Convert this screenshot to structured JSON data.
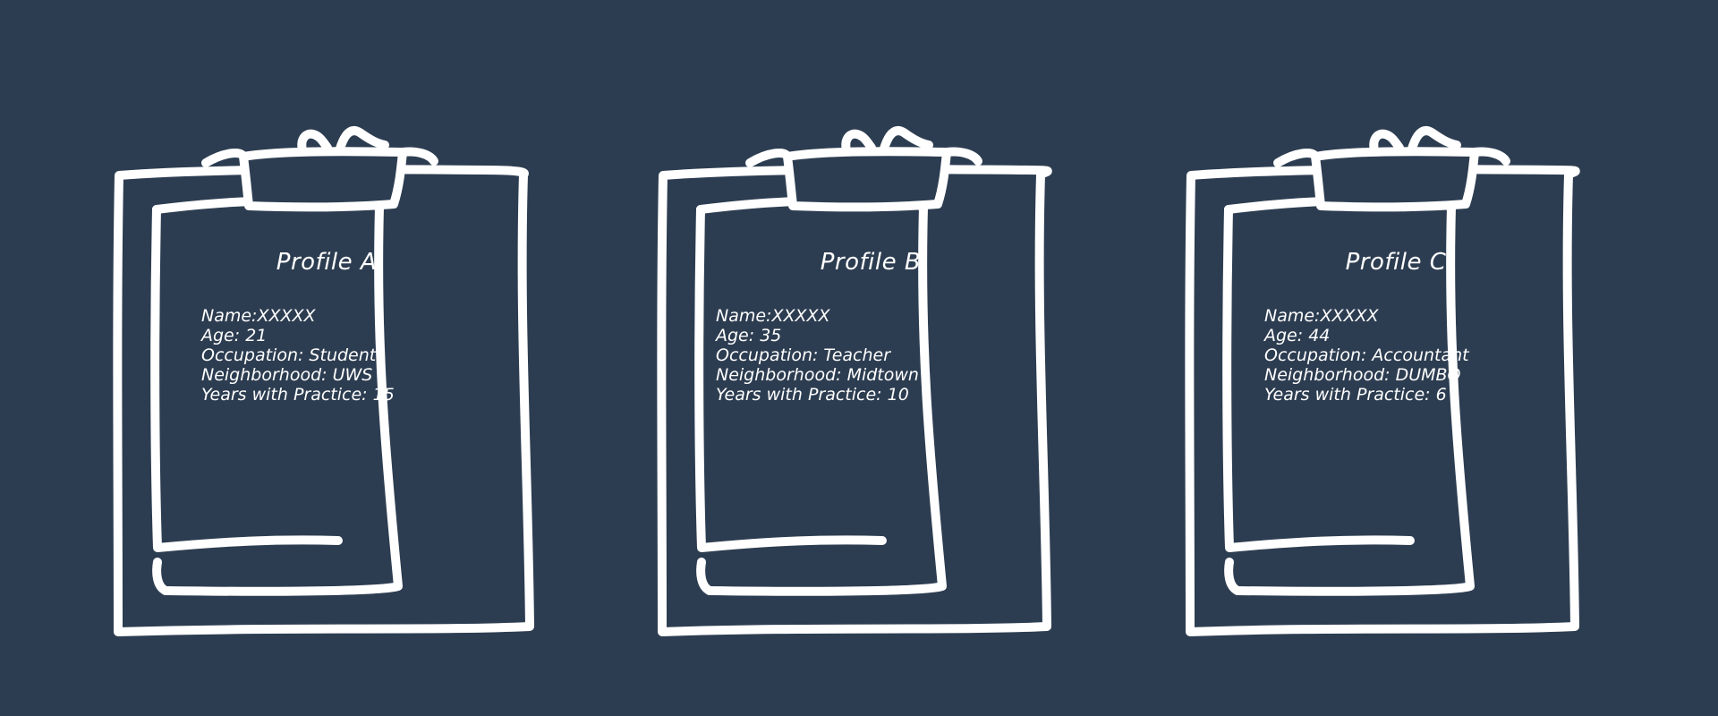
{
  "profiles": [
    {
      "title": "Profile A",
      "name_line": "Name:XXXXX",
      "age_line": "Age: 21",
      "occupation_line": "Occupation: Student",
      "neighborhood_line": "Neighborhood: UWS",
      "years_line": "Years with Practice: 15"
    },
    {
      "title": "Profile B",
      "name_line": "Name:XXXXX",
      "age_line": "Age: 35",
      "occupation_line": "Occupation: Teacher",
      "neighborhood_line": "Neighborhood: Midtown",
      "years_line": "Years with Practice: 10"
    },
    {
      "title": "Profile C",
      "name_line": "Name:XXXXX",
      "age_line": "Age: 44",
      "occupation_line": "Occupation: Accountant",
      "neighborhood_line": "Neighborhood: DUMBO",
      "years_line": "Years with Practice: 6"
    }
  ],
  "colors": {
    "background": "#2d3d51",
    "stroke": "#ffffff",
    "text": "#ffffff"
  },
  "icons": [
    "clipboard-icon",
    "clipboard-icon",
    "clipboard-icon"
  ]
}
